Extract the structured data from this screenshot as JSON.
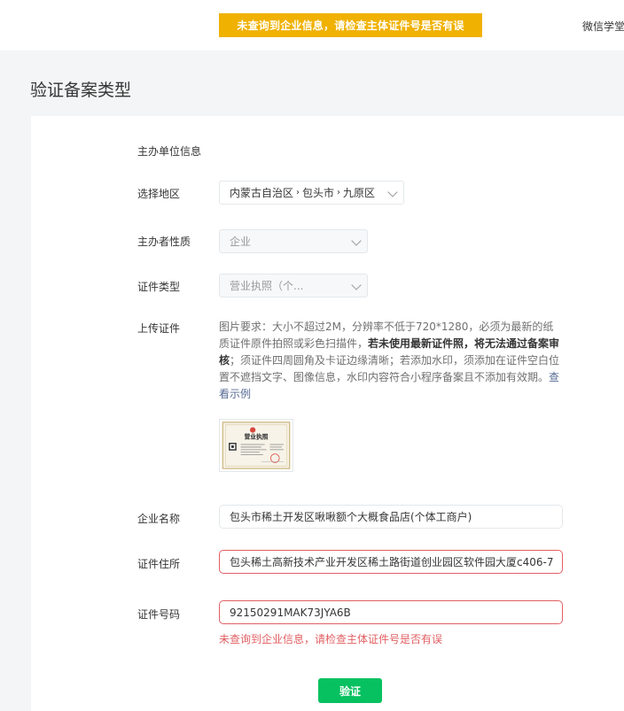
{
  "topbar": {
    "toast": "未查询到企业信息，请检查主体证件号是否有误",
    "link": "微信学堂"
  },
  "page": {
    "title": "验证备案类型"
  },
  "form": {
    "section_label": "主办单位信息",
    "region": {
      "label": "选择地区",
      "province": "内蒙古自治区",
      "city": "包头市",
      "district": "九原区"
    },
    "nature": {
      "label": "主办者性质",
      "value": "企业"
    },
    "cert_type": {
      "label": "证件类型",
      "value": "营业执照（个..."
    },
    "upload": {
      "label": "上传证件",
      "desc_1": "图片要求：大小不超过2M，分辨率不低于720*1280，必须为最新的纸质证件原件拍照或彩色扫描件，",
      "desc_bold": "若未使用最新证件照，将无法通过备案审核",
      "desc_2": "；须证件四周圆角及卡证边缘清晰；若添加水印，须添加在证件空白位置不遮挡文字、图像信息，水印内容符合小程序备案且不添加有效期。",
      "desc_link": "查看示例",
      "thumb_text": "营业执照"
    },
    "company_name": {
      "label": "企业名称",
      "value": "包头市稀土开发区啾啾额个大概食品店(个体工商户)"
    },
    "address": {
      "label": "证件住所",
      "value": "包头稀土高新技术产业开发区稀土路街道创业园区软件园大厦c406-7"
    },
    "cert_no": {
      "label": "证件号码",
      "value": "92150291MAK73JYA6B",
      "error": "未查询到企业信息，请检查主体证件号是否有误"
    },
    "submit_label": "验证"
  },
  "colors": {
    "toast": "#f0b100",
    "error": "#e15f63",
    "primary": "#07c160",
    "link": "#576b95"
  }
}
